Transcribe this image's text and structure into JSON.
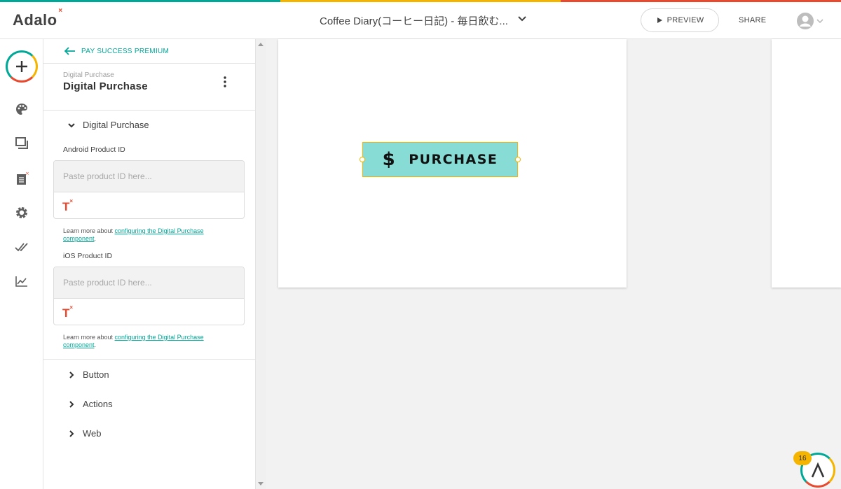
{
  "colors": {
    "stripe": [
      "#00a898",
      "#f5b400",
      "#e84a2f"
    ],
    "accent": "#00a898",
    "button_fill": "#87ddd6",
    "selection": "#f5b400"
  },
  "header": {
    "logo": "Adalo",
    "app_title": "Coffee Diary(コーヒー日記) - 毎日飲む...",
    "preview_label": "PREVIEW",
    "share_label": "SHARE"
  },
  "iconbar": {
    "icons": [
      "add-icon",
      "palette-icon",
      "screens-icon",
      "database-icon",
      "settings-icon",
      "publish-icon",
      "analytics-icon"
    ]
  },
  "panel": {
    "back_label": "PAY SUCCESS PREMIUM",
    "component_type": "Digital Purchase",
    "component_name": "Digital Purchase",
    "section_title": "Digital Purchase",
    "android_label": "Android Product ID",
    "android_placeholder": "Paste product ID here...",
    "ios_label": "iOS Product ID",
    "ios_placeholder": "Paste product ID here...",
    "help_prefix": "Learn more about ",
    "help_link": "configuring the Digital Purchase component",
    "help_suffix": ".",
    "collapsed_sections": [
      "Button",
      "Actions",
      "Web"
    ]
  },
  "canvas": {
    "button_icon": "$",
    "button_label": "PURCHASE"
  },
  "help_badge_count": "16"
}
